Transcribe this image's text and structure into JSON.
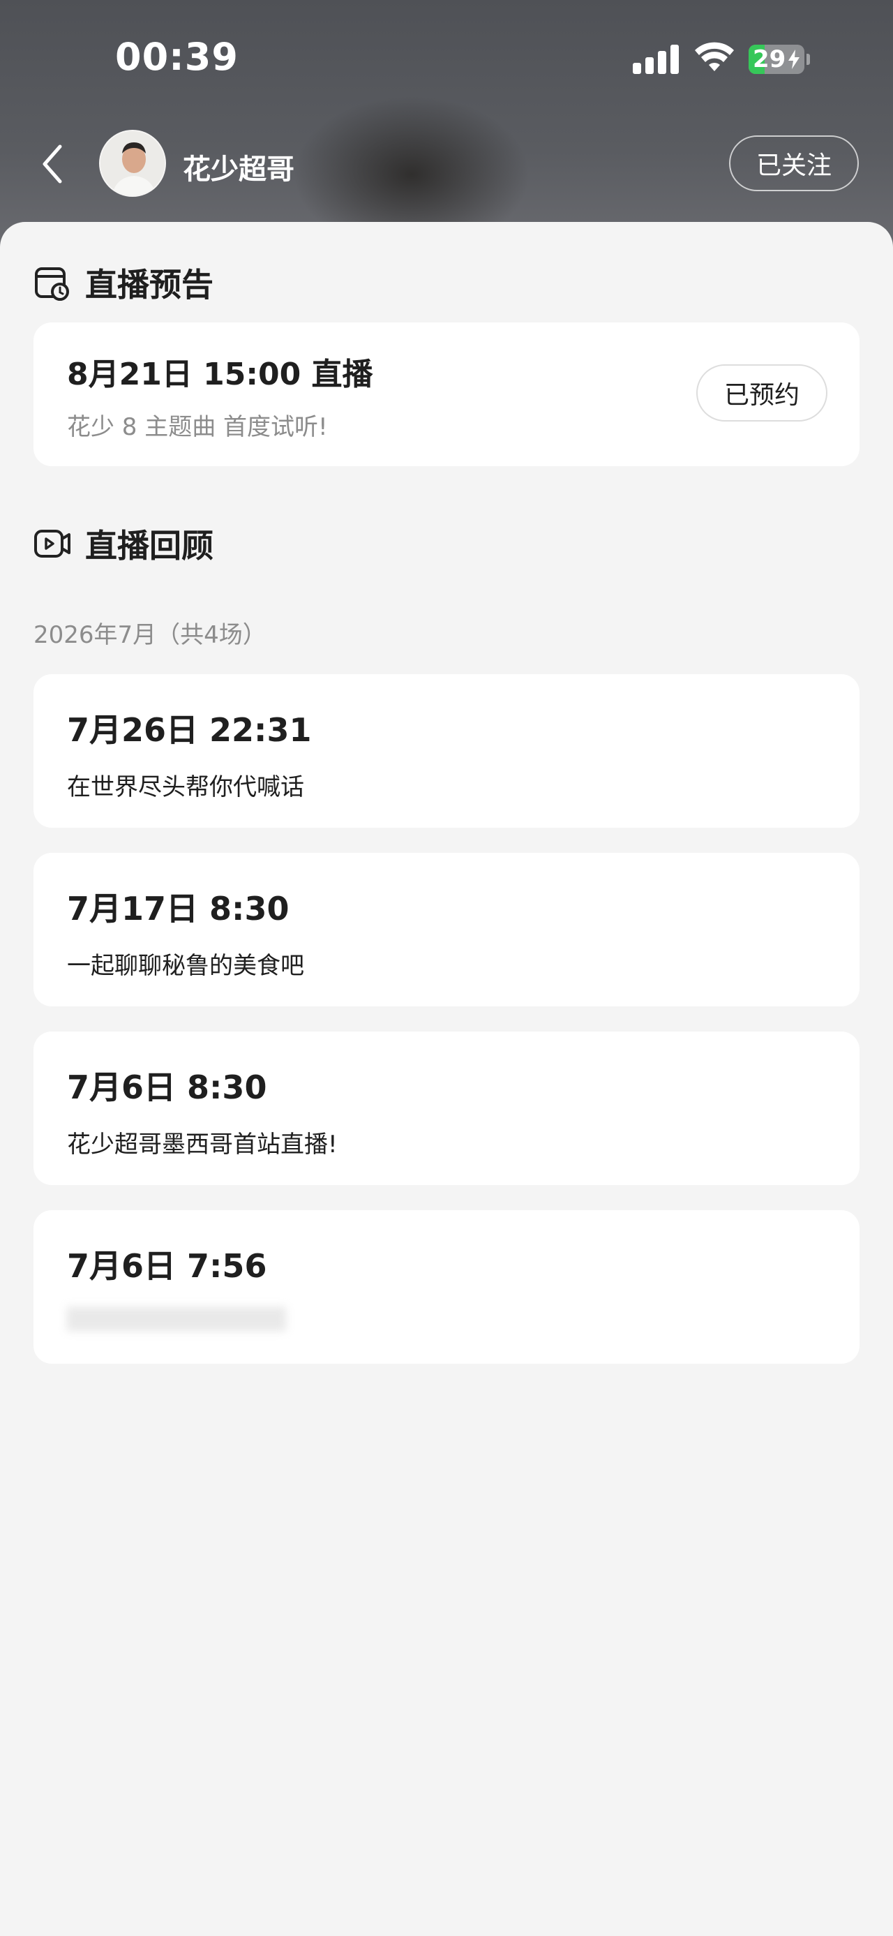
{
  "status_bar": {
    "time": "00:39",
    "battery_level": "29",
    "signal_icon": "cellular-signal-icon",
    "wifi_icon": "wifi-icon",
    "battery_icon": "battery-charging-icon",
    "battery_color": "#36c759"
  },
  "nav": {
    "back_icon": "chevron-left-icon",
    "username": "花少超哥",
    "follow_label": "已关注"
  },
  "preview": {
    "section_icon": "calendar-clock-icon",
    "section_title": "直播预告",
    "title": "8月21日 15:00 直播",
    "subtitle": "花少 8 主题曲 首度试听!",
    "reserve_label": "已预约"
  },
  "replay": {
    "section_icon": "video-camera-icon",
    "section_title": "直播回顾",
    "month_label": "2026年7月（共4场）",
    "items": [
      {
        "time": "7月26日 22:31",
        "desc": "在世界尽头帮你代喊话"
      },
      {
        "time": "7月17日 8:30",
        "desc": "一起聊聊秘鲁的美食吧"
      },
      {
        "time": "7月6日 8:30",
        "desc": "花少超哥墨西哥首站直播!"
      },
      {
        "time": "7月6日 7:56",
        "desc": ""
      }
    ]
  }
}
